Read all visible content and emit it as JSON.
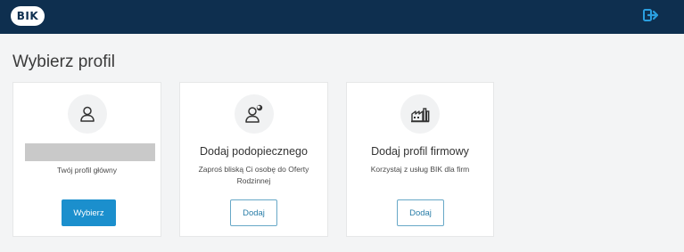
{
  "header": {
    "logo_text": "BIK",
    "logout_icon": "logout-icon",
    "background": "#0e2f4f"
  },
  "page": {
    "title": "Wybierz profil"
  },
  "cards": [
    {
      "icon": "person-icon",
      "name_masked": true,
      "description": "Twój profil główny",
      "button_label": "Wybierz"
    },
    {
      "icon": "person-plus-icon",
      "title": "Dodaj podopiecznego",
      "description": "Zaproś bliską Ci osobę do Oferty Rodzinnej",
      "button_label": "Dodaj"
    },
    {
      "icon": "factory-icon",
      "title": "Dodaj profil firmowy",
      "description": "Korzystaj z usług BIK dla firm",
      "button_label": "Dodaj"
    }
  ],
  "colors": {
    "accent": "#1b8fcd",
    "outline": "#67a8c7"
  }
}
